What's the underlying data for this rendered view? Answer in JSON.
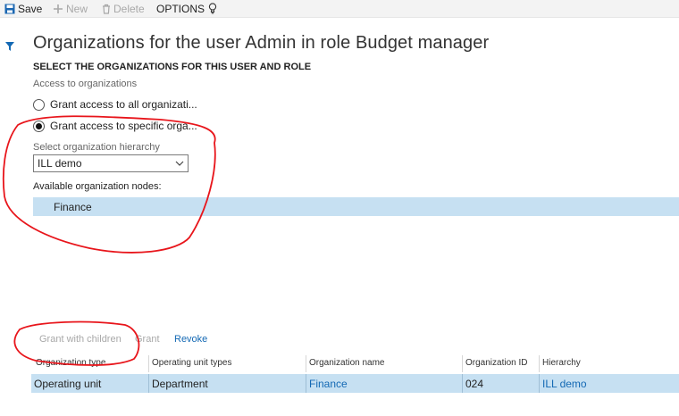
{
  "toolbar": {
    "save_label": "Save",
    "new_label": "New",
    "delete_label": "Delete",
    "options_label": "OPTIONS"
  },
  "page": {
    "title": "Organizations for the user Admin in role Budget manager",
    "section_heading": "SELECT THE ORGANIZATIONS FOR THIS USER AND ROLE",
    "access_label": "Access to organizations"
  },
  "radios": [
    {
      "label": "Grant access to all organizati...",
      "selected": false
    },
    {
      "label": "Grant access to specific orga...",
      "selected": true
    }
  ],
  "hierarchy": {
    "label": "Select organization hierarchy",
    "value": "ILL demo"
  },
  "nodes": {
    "label": "Available organization nodes:",
    "items": [
      "Finance"
    ]
  },
  "actions": {
    "grant_with_children": "Grant with children",
    "grant": "Grant",
    "revoke": "Revoke"
  },
  "grid": {
    "columns": [
      "Organization type",
      "Operating unit types",
      "Organization name",
      "Organization ID",
      "Hierarchy"
    ],
    "rows": [
      [
        "Operating unit",
        "Department",
        "Finance",
        "024",
        "ILL demo"
      ]
    ]
  },
  "colors": {
    "accent": "#1469b4",
    "selection": "#c6e0f2",
    "annotation": "#e8151b"
  },
  "icons": [
    "save-icon",
    "plus-icon",
    "trash-icon",
    "lightbulb-icon",
    "filter-icon",
    "chevron-down-icon"
  ]
}
